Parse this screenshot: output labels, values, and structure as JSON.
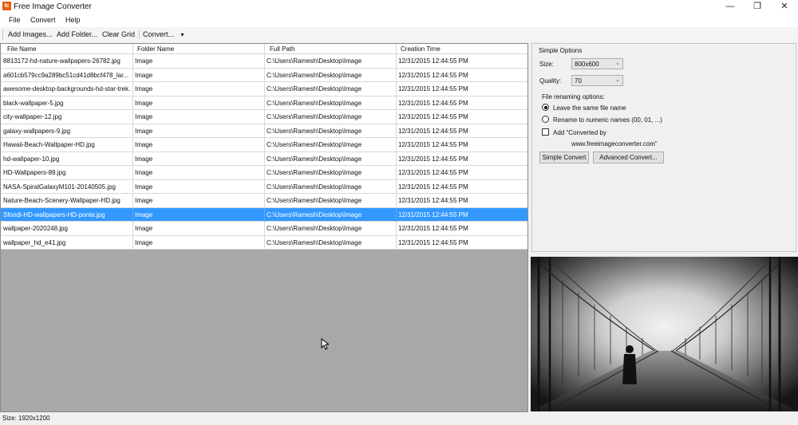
{
  "window": {
    "title": "Free Image Converter",
    "icon_text": "Ic",
    "controls": {
      "minimize": "—",
      "maximize": "❐",
      "close": "✕"
    }
  },
  "menu": [
    "File",
    "Convert",
    "Help"
  ],
  "toolbar": {
    "add_images": "Add Images...",
    "add_folder": "Add Folder...",
    "clear_grid": "Clear Grid",
    "convert": "Convert...",
    "convert_arrow": "▾"
  },
  "grid": {
    "columns": [
      "File Name",
      "Folder Name",
      "Full Path",
      "Creation Time"
    ],
    "selected_index": 11,
    "rows": [
      [
        "8813172-hd-nature-wallpapers-26782.jpg",
        "Image",
        "C:\\Users\\Ramesh\\Desktop\\Image",
        "12/31/2015 12:44:55 PM"
      ],
      [
        "a601cb579cc9a289bc51cd41d8bcf478_lar...",
        "Image",
        "C:\\Users\\Ramesh\\Desktop\\Image",
        "12/31/2015 12:44:55 PM"
      ],
      [
        "awesome-desktop-backgrounds-hd-star-trek...",
        "Image",
        "C:\\Users\\Ramesh\\Desktop\\Image",
        "12/31/2015 12:44:55 PM"
      ],
      [
        "black-wallpaper-5.jpg",
        "Image",
        "C:\\Users\\Ramesh\\Desktop\\Image",
        "12/31/2015 12:44:55 PM"
      ],
      [
        "city-wallpaper-12.jpg",
        "Image",
        "C:\\Users\\Ramesh\\Desktop\\Image",
        "12/31/2015 12:44:55 PM"
      ],
      [
        "galaxy-wallpapers-9.jpg",
        "Image",
        "C:\\Users\\Ramesh\\Desktop\\Image",
        "12/31/2015 12:44:55 PM"
      ],
      [
        "Hawaii-Beach-Wallpaper-HD.jpg",
        "Image",
        "C:\\Users\\Ramesh\\Desktop\\Image",
        "12/31/2015 12:44:55 PM"
      ],
      [
        "hd-wallpaper-10.jpg",
        "Image",
        "C:\\Users\\Ramesh\\Desktop\\Image",
        "12/31/2015 12:44:55 PM"
      ],
      [
        "HD-Wallpapers-89.jpg",
        "Image",
        "C:\\Users\\Ramesh\\Desktop\\Image",
        "12/31/2015 12:44:55 PM"
      ],
      [
        "NASA-SpiralGalaxyM101-20140505.jpg",
        "Image",
        "C:\\Users\\Ramesh\\Desktop\\Image",
        "12/31/2015 12:44:55 PM"
      ],
      [
        "Nature-Beach-Scenery-Wallpaper-HD.jpg",
        "Image",
        "C:\\Users\\Ramesh\\Desktop\\Image",
        "12/31/2015 12:44:55 PM"
      ],
      [
        "Sfondi-HD-wallpapers-HD-ponte.jpg",
        "Image",
        "C:\\Users\\Ramesh\\Desktop\\Image",
        "12/31/2015 12:44:55 PM"
      ],
      [
        "wallpaper-2020248.jpg",
        "Image",
        "C:\\Users\\Ramesh\\Desktop\\Image",
        "12/31/2015 12:44:55 PM"
      ],
      [
        "wallpaper_hd_e41.jpg",
        "Image",
        "C:\\Users\\Ramesh\\Desktop\\Image",
        "12/31/2015 12:44:55 PM"
      ]
    ]
  },
  "options": {
    "title": "Simple Options",
    "size_label": "Size:",
    "size_value": "800x600",
    "quality_label": "Quality:",
    "quality_value": "70",
    "renaming_label": "File renaming options:",
    "radio_same": "Leave the same file name",
    "radio_numeric": "Rename to numeric names (00, 01, ...)",
    "add_converted": "Add \"Converted by",
    "add_converted_url": "www.freeimageconverter.com\"",
    "simple_convert": "Simple Convert",
    "advanced_convert": "Advanced Convert..."
  },
  "status": {
    "text": "Size: 1920x1200"
  },
  "colors": {
    "selection": "#3399ff",
    "grid_background": "#a8a8a8",
    "app_icon": "#e8620f"
  }
}
